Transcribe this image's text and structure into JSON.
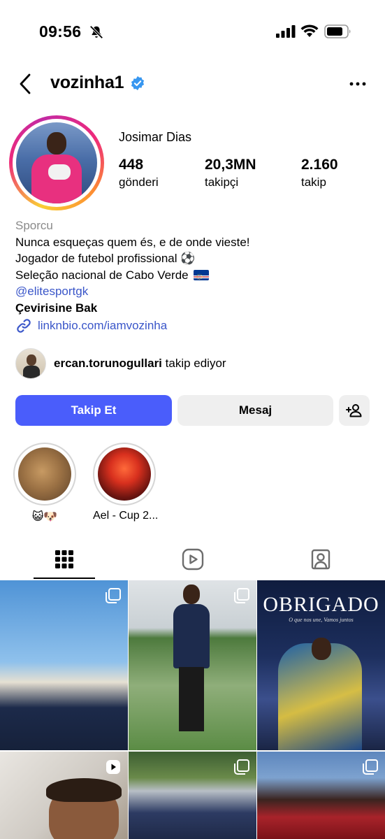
{
  "status_bar": {
    "time": "09:56"
  },
  "header": {
    "username": "vozinha1"
  },
  "profile": {
    "full_name": "Josimar Dias",
    "stats": [
      {
        "value": "448",
        "label": "gönderi"
      },
      {
        "value": "20,3MN",
        "label": "takipçi"
      },
      {
        "value": "2.160",
        "label": "takip"
      }
    ],
    "category": "Sporcu",
    "bio_lines": [
      "Nunca esqueças quem és, e de onde vieste!",
      "Jogador de futebol profissional ⚽",
      "Seleção nacional de Cabo Verde"
    ],
    "mention": "@elitesportgk",
    "translate_label": "Çevirisine Bak",
    "link": "linknbio.com/iamvozinha"
  },
  "followed_by": {
    "name": "ercan.torunogullari",
    "suffix": " takip ediyor"
  },
  "buttons": {
    "follow": "Takip Et",
    "message": "Mesaj"
  },
  "highlights": [
    {
      "label": "😺🐶"
    },
    {
      "label": "Ael - Cup 2..."
    }
  ],
  "grid": {
    "posts": [
      {
        "type": "carousel"
      },
      {
        "type": "carousel"
      },
      {
        "type": "image",
        "overlay_title": "OBRIGADO",
        "overlay_subtitle": "O que nos une, Vamos juntos"
      },
      {
        "type": "video"
      },
      {
        "type": "carousel"
      },
      {
        "type": "carousel"
      }
    ]
  },
  "colors": {
    "follow_button": "#4a5dfb",
    "link": "#3a56c9",
    "verified": "#3897f0"
  }
}
